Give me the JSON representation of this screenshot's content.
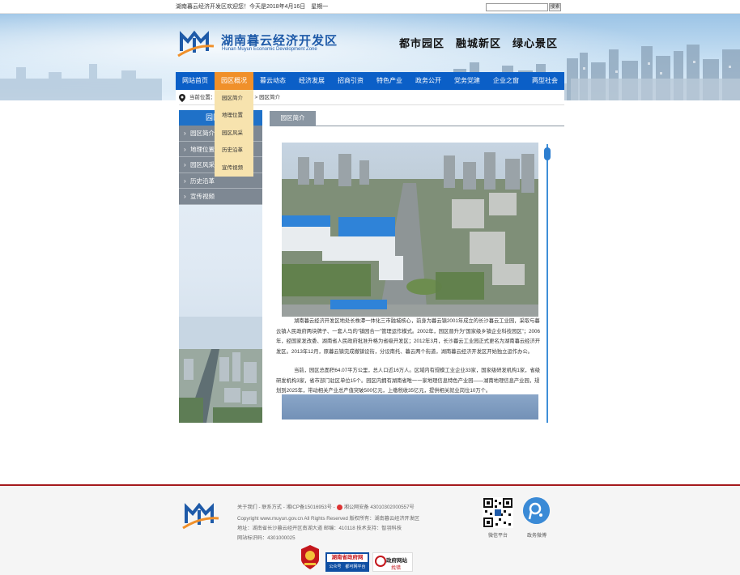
{
  "topbar": {
    "welcome": "湖南暮云经济开发区欢迎您！今天是2018年4月16日　星期一",
    "search_placeholder": "",
    "search_button": "搜索"
  },
  "header": {
    "title": "湖南暮云经济开发区",
    "subtitle": "Hunan Muyun Economic Development Zone",
    "slogan": "都市园区　融城新区　绿心景区"
  },
  "nav": {
    "active_index": 1,
    "items": [
      "网站首页",
      "园区概况",
      "暮云动态",
      "经济发展",
      "招商引资",
      "特色产业",
      "政务公开",
      "党务党建",
      "企业之窗",
      "两型社会"
    ]
  },
  "dropdown": {
    "items": [
      "园区简介",
      "地理位置",
      "园区风采",
      "历史沿革",
      "宣传视频"
    ]
  },
  "breadcrumb": {
    "label": "当前位置：",
    "path": "首页 > 园区概况 > 园区简介"
  },
  "sidebar": {
    "heading": "园区概况",
    "items": [
      "园区简介",
      "地理位置",
      "园区风采",
      "历史沿革",
      "宣传视频"
    ]
  },
  "content": {
    "tab": "园区简介",
    "paragraphs": [
      "湖南暮云经济开发区地处长株潭一体化三市融城核心，前身为暮云镇2001年成立的长沙暮云工业园，采取与暮云镇人民政府两块牌子、一套人马的“镇园合一”管理运作模式。2002年，园区晋升为“国家级乡镇企业科技园区”；2006年，经国家发改委、湖南省人民政府批准升格为省级开发区；2012年3月，长沙暮云工业园正式更名为湖南暮云经济开发区。2013年12月，原暮云镇完成撤镇设街，分设南托、暮云两个街道，湖南暮云经济开发区开始独立运作办公。",
      "当前，园区总面积64.07平方公里，总人口近16万人。区域内有规模工业企业33家，国家级研发机构1家，省级研发机构3家，省市部门驻区单位15个。园区内拥有湖南省唯一一家地理信息特色产业园——湖南地理信息产业园，规划到2025年，带动相关产业总产值突破500亿元，上缴税收35亿元，提供相关就业岗位10万个。"
    ]
  },
  "footer": {
    "line1_links": "关于我们 - 联系方式 - 湘ICP备15016953号 -",
    "line1_police": "湘公网安备 43010302000557号",
    "line2": "Copyright www.muyun.gov.cn All Rights Reserved  版权所有：湖南暮云经济开发区",
    "line3": "地址：湖南省长沙暮云经开区南湖大道  邮编：410118  技术支持：智羽科技",
    "line4": "网站标识码：4301000025",
    "qr_label": "微信平台",
    "weibo_label": "政务微博",
    "badge_gov_title": "湖南省政府网",
    "badge_gov_sub": "公众号　都可网平台",
    "badge_error_title": "政府网站",
    "badge_error_sub": "找错"
  },
  "colors": {
    "nav_blue": "#0b5fc7",
    "nav_active": "#f0902a",
    "dropdown_bg": "#f7e3ae",
    "sidebar_item": "#7e8893",
    "footer_border": "#a5191c"
  }
}
